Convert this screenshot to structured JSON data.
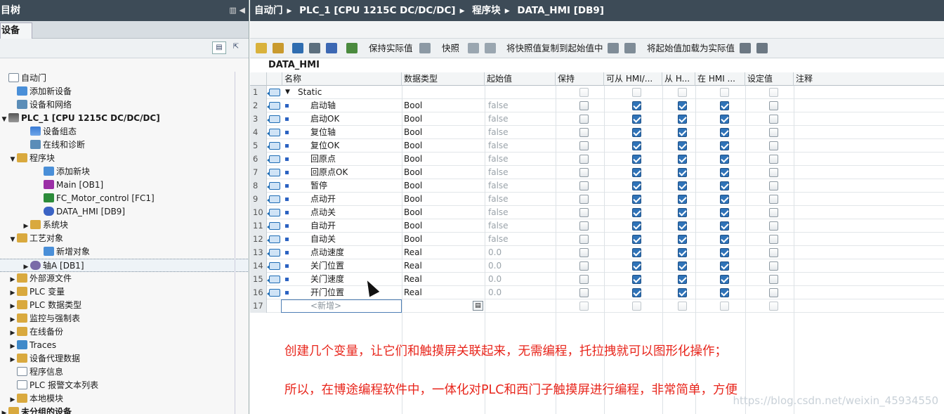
{
  "left_panel": {
    "title": "目树",
    "tab": "设备",
    "tree": [
      {
        "label": "自动门",
        "icon": "project-icon",
        "level": 0,
        "expander": "none"
      },
      {
        "label": "添加新设备",
        "icon": "add-device-icon",
        "level": 1,
        "expander": "none"
      },
      {
        "label": "设备和网络",
        "icon": "network-icon",
        "level": 1,
        "expander": "none"
      },
      {
        "label": "PLC_1 [CPU 1215C DC/DC/DC]",
        "icon": "cpu-icon",
        "level": 0,
        "expander": "down",
        "bold": true
      },
      {
        "label": "设备组态",
        "icon": "device-config-icon",
        "level": 2,
        "expander": "none"
      },
      {
        "label": "在线和诊断",
        "icon": "online-diag-icon",
        "level": 2,
        "expander": "none"
      },
      {
        "label": "程序块",
        "icon": "folder-icon",
        "level": 1,
        "expander": "down"
      },
      {
        "label": "添加新块",
        "icon": "add-block-icon",
        "level": 3,
        "expander": "none"
      },
      {
        "label": "Main [OB1]",
        "icon": "ob-icon",
        "level": 3,
        "expander": "none"
      },
      {
        "label": "FC_Motor_control [FC1]",
        "icon": "fc-icon",
        "level": 3,
        "expander": "none"
      },
      {
        "label": "DATA_HMI [DB9]",
        "icon": "db-icon",
        "level": 3,
        "expander": "none"
      },
      {
        "label": "系统块",
        "icon": "folder-icon",
        "level": 2,
        "expander": "right"
      },
      {
        "label": "工艺对象",
        "icon": "folder-icon",
        "level": 1,
        "expander": "down"
      },
      {
        "label": "新增对象",
        "icon": "add-object-icon",
        "level": 3,
        "expander": "none"
      },
      {
        "label": "轴A [DB1]",
        "icon": "axis-icon",
        "level": 2,
        "expander": "right",
        "selected": true
      },
      {
        "label": "外部源文件",
        "icon": "folder-icon",
        "level": 1,
        "expander": "right"
      },
      {
        "label": "PLC 变量",
        "icon": "folder-icon",
        "level": 1,
        "expander": "right"
      },
      {
        "label": "PLC 数据类型",
        "icon": "folder-icon",
        "level": 1,
        "expander": "right"
      },
      {
        "label": "监控与强制表",
        "icon": "folder-icon",
        "level": 1,
        "expander": "right"
      },
      {
        "label": "在线备份",
        "icon": "folder-icon",
        "level": 1,
        "expander": "right"
      },
      {
        "label": "Traces",
        "icon": "trace-icon",
        "level": 1,
        "expander": "right"
      },
      {
        "label": "设备代理数据",
        "icon": "folder-icon",
        "level": 1,
        "expander": "right"
      },
      {
        "label": "程序信息",
        "icon": "doc-icon",
        "level": 1,
        "expander": "none"
      },
      {
        "label": "PLC 报警文本列表",
        "icon": "doc-icon",
        "level": 1,
        "expander": "none"
      },
      {
        "label": "本地模块",
        "icon": "folder-icon",
        "level": 1,
        "expander": "right"
      },
      {
        "label": "未分组的设备",
        "icon": "folder-icon",
        "level": 0,
        "expander": "right",
        "bold": true
      }
    ]
  },
  "breadcrumb": [
    "自动门",
    "PLC_1 [CPU 1215C DC/DC/DC]",
    "程序块",
    "DATA_HMI [DB9]"
  ],
  "toolbar": {
    "keep_actual": "保持实际值",
    "snapshot": "快照",
    "copy_snapshot": "将快照值复制到起始值中",
    "load_start": "将起始值加载为实际值"
  },
  "db_title": "DATA_HMI",
  "columns": [
    "名称",
    "数据类型",
    "起始值",
    "保持",
    "可从 HMI/...",
    "从 H...",
    "在 HMI ...",
    "设定值",
    "注释"
  ],
  "rows": [
    {
      "n": "1",
      "name": "Static",
      "type": "",
      "start": "",
      "retain": false,
      "hmi_access": false,
      "hmi_visible": false,
      "hmi_in": false,
      "setpoint": false,
      "static": true
    },
    {
      "n": "2",
      "name": "启动轴",
      "type": "Bool",
      "start": "false",
      "retain": false,
      "hmi_access": true,
      "hmi_visible": true,
      "hmi_in": true,
      "setpoint": false
    },
    {
      "n": "3",
      "name": "启动OK",
      "type": "Bool",
      "start": "false",
      "retain": false,
      "hmi_access": true,
      "hmi_visible": true,
      "hmi_in": true,
      "setpoint": false
    },
    {
      "n": "4",
      "name": "复位轴",
      "type": "Bool",
      "start": "false",
      "retain": false,
      "hmi_access": true,
      "hmi_visible": true,
      "hmi_in": true,
      "setpoint": false
    },
    {
      "n": "5",
      "name": "复位OK",
      "type": "Bool",
      "start": "false",
      "retain": false,
      "hmi_access": true,
      "hmi_visible": true,
      "hmi_in": true,
      "setpoint": false
    },
    {
      "n": "6",
      "name": "回原点",
      "type": "Bool",
      "start": "false",
      "retain": false,
      "hmi_access": true,
      "hmi_visible": true,
      "hmi_in": true,
      "setpoint": false
    },
    {
      "n": "7",
      "name": "回原点OK",
      "type": "Bool",
      "start": "false",
      "retain": false,
      "hmi_access": true,
      "hmi_visible": true,
      "hmi_in": true,
      "setpoint": false
    },
    {
      "n": "8",
      "name": "暂停",
      "type": "Bool",
      "start": "false",
      "retain": false,
      "hmi_access": true,
      "hmi_visible": true,
      "hmi_in": true,
      "setpoint": false
    },
    {
      "n": "9",
      "name": "点动开",
      "type": "Bool",
      "start": "false",
      "retain": false,
      "hmi_access": true,
      "hmi_visible": true,
      "hmi_in": true,
      "setpoint": false
    },
    {
      "n": "10",
      "name": "点动关",
      "type": "Bool",
      "start": "false",
      "retain": false,
      "hmi_access": true,
      "hmi_visible": true,
      "hmi_in": true,
      "setpoint": false
    },
    {
      "n": "11",
      "name": "自动开",
      "type": "Bool",
      "start": "false",
      "retain": false,
      "hmi_access": true,
      "hmi_visible": true,
      "hmi_in": true,
      "setpoint": false
    },
    {
      "n": "12",
      "name": "自动关",
      "type": "Bool",
      "start": "false",
      "retain": false,
      "hmi_access": true,
      "hmi_visible": true,
      "hmi_in": true,
      "setpoint": false
    },
    {
      "n": "13",
      "name": "点动速度",
      "type": "Real",
      "start": "0.0",
      "retain": false,
      "hmi_access": true,
      "hmi_visible": true,
      "hmi_in": true,
      "setpoint": false
    },
    {
      "n": "14",
      "name": "关门位置",
      "type": "Real",
      "start": "0.0",
      "retain": false,
      "hmi_access": true,
      "hmi_visible": true,
      "hmi_in": true,
      "setpoint": false
    },
    {
      "n": "15",
      "name": "关门速度",
      "type": "Real",
      "start": "0.0",
      "retain": false,
      "hmi_access": true,
      "hmi_visible": true,
      "hmi_in": true,
      "setpoint": false
    },
    {
      "n": "16",
      "name": "开门位置",
      "type": "Real",
      "start": "0.0",
      "retain": false,
      "hmi_access": true,
      "hmi_visible": true,
      "hmi_in": true,
      "setpoint": false
    },
    {
      "n": "17",
      "name": "<新增>",
      "type": "",
      "start": "",
      "retain": false,
      "hmi_access": false,
      "hmi_visible": false,
      "hmi_in": false,
      "setpoint": false,
      "new": true
    }
  ],
  "annotations": [
    "创建几个变量，让它们和触摸屏关联起来，无需编程，托拉拽就可以图形化操作；",
    "所以，在博途编程软件中，一体化对PLC和西门子触摸屏进行编程，非常简单，方便"
  ],
  "watermark": "https://blog.csdn.net/weixin_45934550",
  "colors": {
    "title_bar": "#3d4b57",
    "accent": "#2f73b8",
    "annotation": "#e8261c"
  }
}
